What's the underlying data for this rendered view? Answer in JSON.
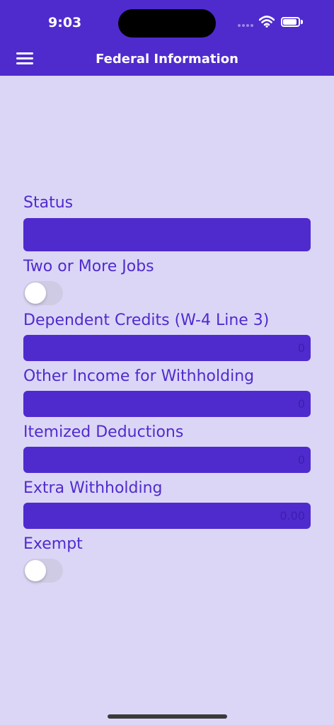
{
  "status_bar": {
    "time": "9:03"
  },
  "nav": {
    "title": "Federal Information"
  },
  "form": {
    "status_label": "Status",
    "status_value": "",
    "two_jobs_label": "Two or More Jobs",
    "two_jobs_on": false,
    "dependent_label": "Dependent Credits (W-4 Line 3)",
    "dependent_value": "0",
    "other_income_label": "Other Income for Withholding",
    "other_income_value": "0",
    "itemized_label": "Itemized Deductions",
    "itemized_value": "0",
    "extra_label": "Extra Withholding",
    "extra_value": "0.00",
    "exempt_label": "Exempt",
    "exempt_on": false
  },
  "colors": {
    "accent": "#4f2bce",
    "background": "#dcd6f6"
  },
  "icons": {
    "menu": "hamburger-menu-icon",
    "wifi": "wifi-icon",
    "battery": "battery-icon",
    "signal": "cellular-signal-icon"
  }
}
